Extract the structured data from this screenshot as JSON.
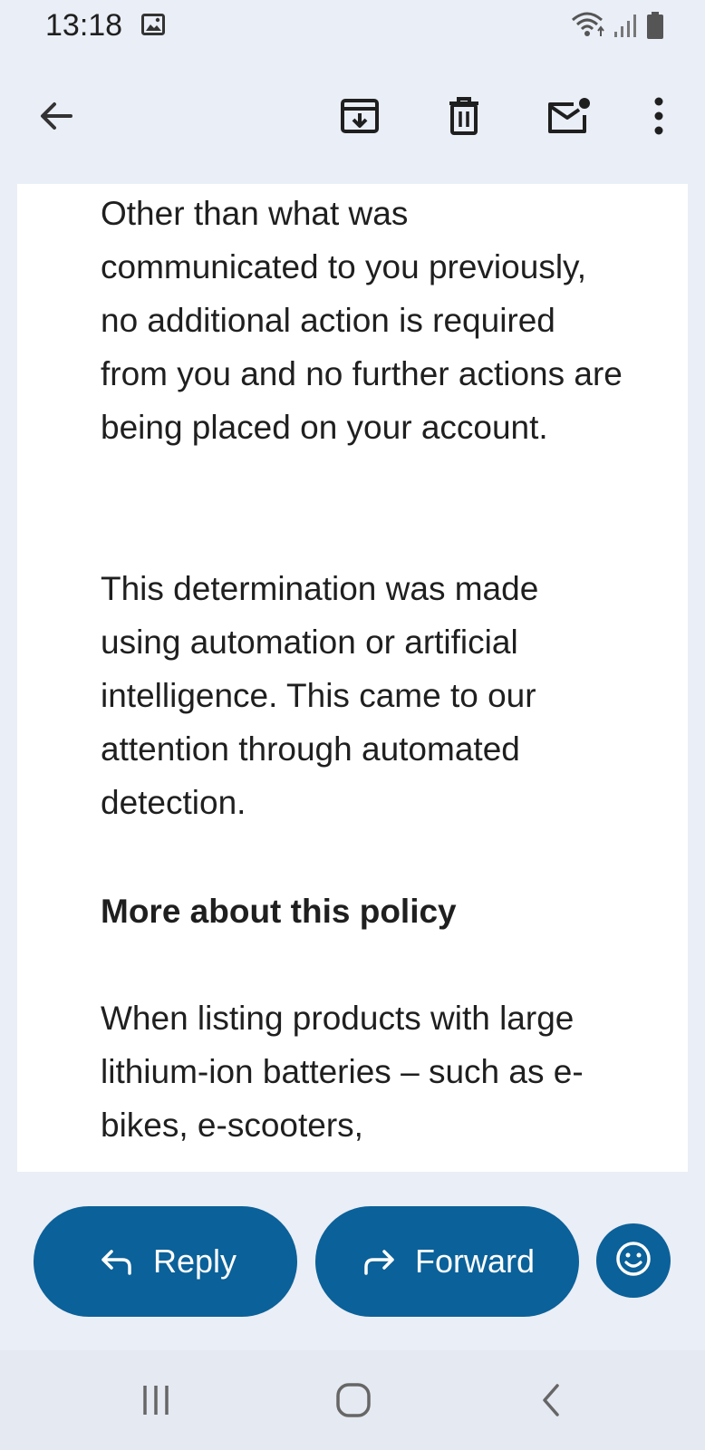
{
  "status_bar": {
    "time": "13:18",
    "icons": [
      "gallery-icon",
      "wifi-icon",
      "signal-icon",
      "battery-icon"
    ]
  },
  "toolbar": {
    "icons": [
      "back-arrow-icon",
      "archive-icon",
      "delete-icon",
      "mark-unread-icon",
      "more-options-icon"
    ]
  },
  "email": {
    "paragraph1": "Other than what was communicated to you previously, no additional action is required from you and no further actions are being placed on your account.",
    "paragraph2": "This determination was made using automation or artificial intelligence. This came to our attention through automated detection.",
    "heading": "More about this policy",
    "paragraph3": "When listing products with large lithium-ion batteries – such as e-bikes, e-scooters,"
  },
  "actions": {
    "reply_label": "Reply",
    "forward_label": "Forward",
    "icons": [
      "reply-icon",
      "forward-icon",
      "emoji-icon"
    ]
  },
  "navigation": {
    "icons": [
      "recent-apps-icon",
      "home-icon",
      "back-icon"
    ]
  },
  "colors": {
    "accent": "#0b6199",
    "background": "#eaeef6",
    "content_background": "#ffffff",
    "text": "#1f1f1f"
  }
}
